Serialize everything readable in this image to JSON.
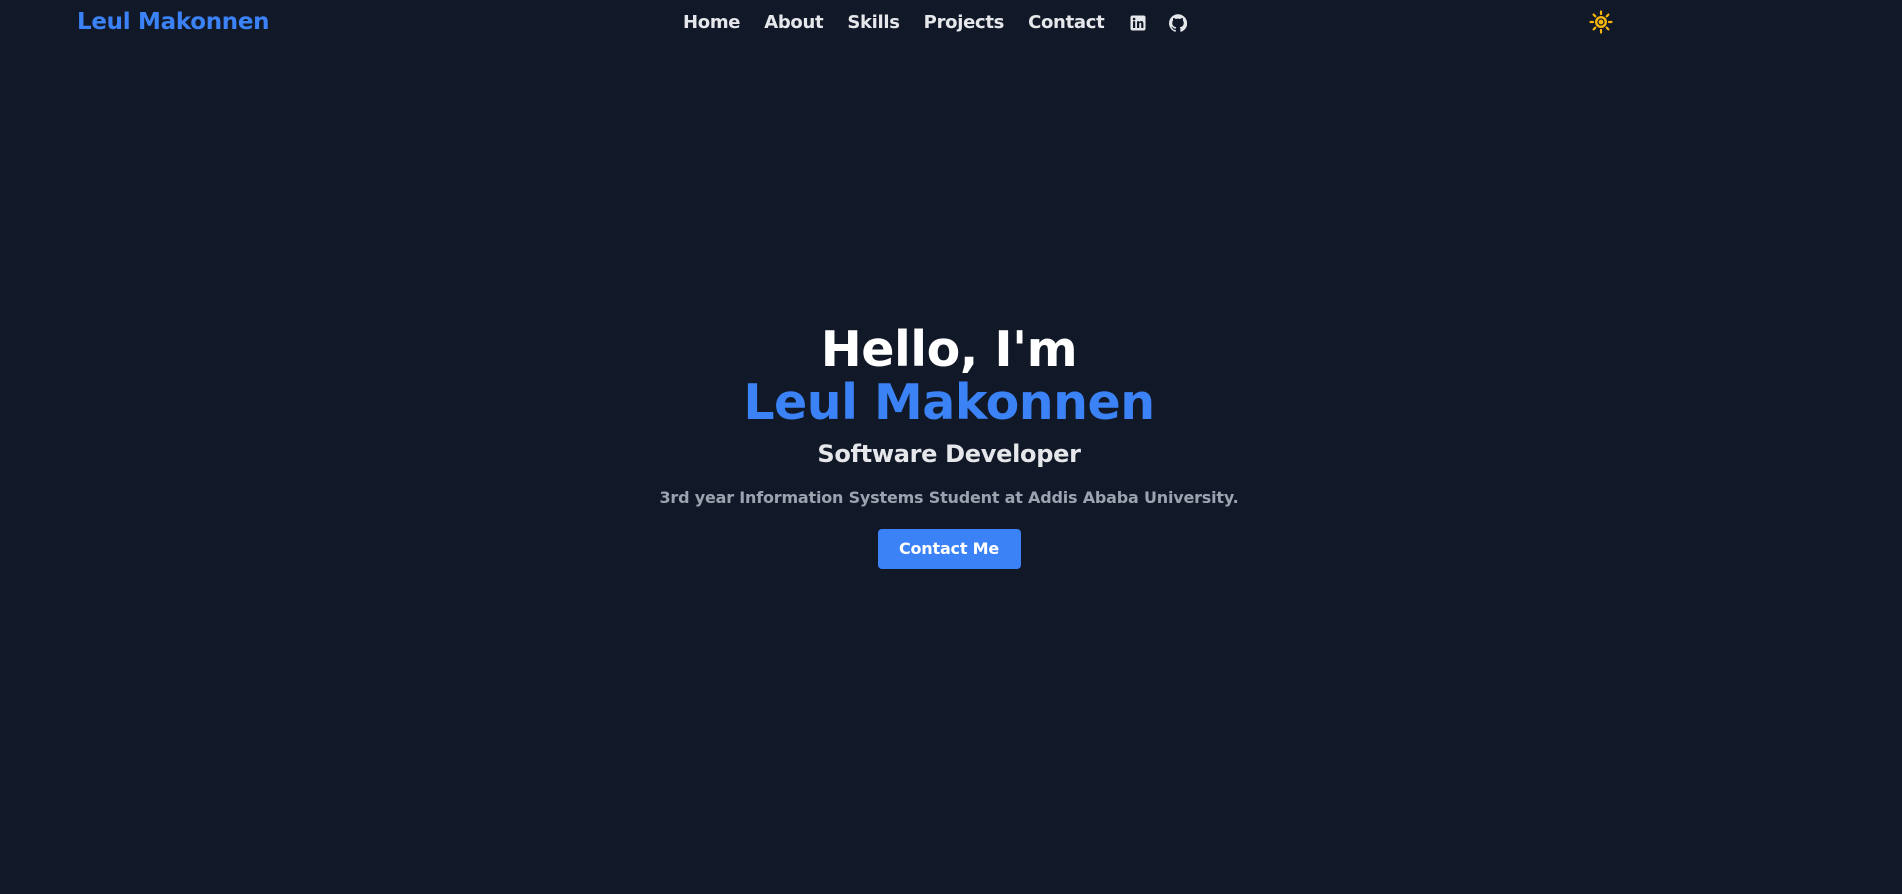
{
  "navbar": {
    "brand": "Leul Makonnen",
    "links": [
      {
        "label": "Home"
      },
      {
        "label": "About"
      },
      {
        "label": "Skills"
      },
      {
        "label": "Projects"
      },
      {
        "label": "Contact"
      }
    ],
    "icons": [
      "linkedin-icon",
      "github-icon"
    ],
    "theme_icon": "sun-icon"
  },
  "hero": {
    "greeting": "Hello, I'm",
    "name": "Leul Makonnen",
    "role": "Software Developer",
    "description": "3rd year Information Systems Student at Addis Ababa University.",
    "cta_label": "Contact Me"
  },
  "colors": {
    "background": "#111827",
    "accent": "#3b82f6",
    "text": "#e5e7eb",
    "muted": "#9ca3af",
    "sun": "#f5b50c"
  }
}
